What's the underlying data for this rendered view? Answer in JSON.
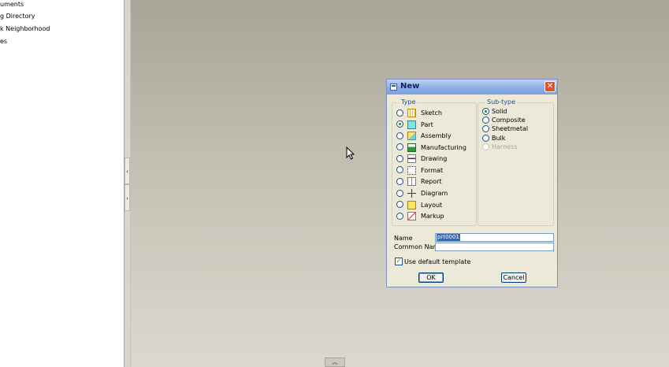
{
  "navigator": {
    "items": [
      "uments",
      "g Directory",
      "k Neighborhood",
      "es"
    ]
  },
  "dialog": {
    "title": "New",
    "close_symbol": "✕",
    "type_group": {
      "label": "Type",
      "options": [
        {
          "label": "Sketch",
          "icon": "sketch-icon",
          "selected": false
        },
        {
          "label": "Part",
          "icon": "part-icon",
          "selected": true
        },
        {
          "label": "Assembly",
          "icon": "assembly-icon",
          "selected": false
        },
        {
          "label": "Manufacturing",
          "icon": "manufacturing-icon",
          "selected": false
        },
        {
          "label": "Drawing",
          "icon": "drawing-icon",
          "selected": false
        },
        {
          "label": "Format",
          "icon": "format-icon",
          "selected": false
        },
        {
          "label": "Report",
          "icon": "report-icon",
          "selected": false
        },
        {
          "label": "Diagram",
          "icon": "diagram-icon",
          "selected": false
        },
        {
          "label": "Layout",
          "icon": "layout-icon",
          "selected": false
        },
        {
          "label": "Markup",
          "icon": "markup-icon",
          "selected": false
        }
      ]
    },
    "subtype_group": {
      "label": "Sub-type",
      "options": [
        {
          "label": "Solid",
          "selected": true,
          "enabled": true
        },
        {
          "label": "Composite",
          "selected": false,
          "enabled": true
        },
        {
          "label": "Sheetmetal",
          "selected": false,
          "enabled": true
        },
        {
          "label": "Bulk",
          "selected": false,
          "enabled": true
        },
        {
          "label": "Harness",
          "selected": false,
          "enabled": false
        }
      ]
    },
    "name_label": "Name",
    "name_value": "prt0001",
    "common_name_label": "Common Name",
    "common_name_value": "",
    "use_default_template_label": "Use default template",
    "use_default_template_checked": true,
    "checkmark": "✓",
    "ok_label": "OK",
    "cancel_label": "Cancel"
  },
  "splitter": {
    "arrow_left": "‹",
    "arrow_right": "›"
  },
  "bottom_tab_symbol": "︽",
  "colors": {
    "title_text": "#0e2463",
    "group_label": "#1f4da8",
    "selection": "#316ac5",
    "close_button": "#d9562f"
  }
}
